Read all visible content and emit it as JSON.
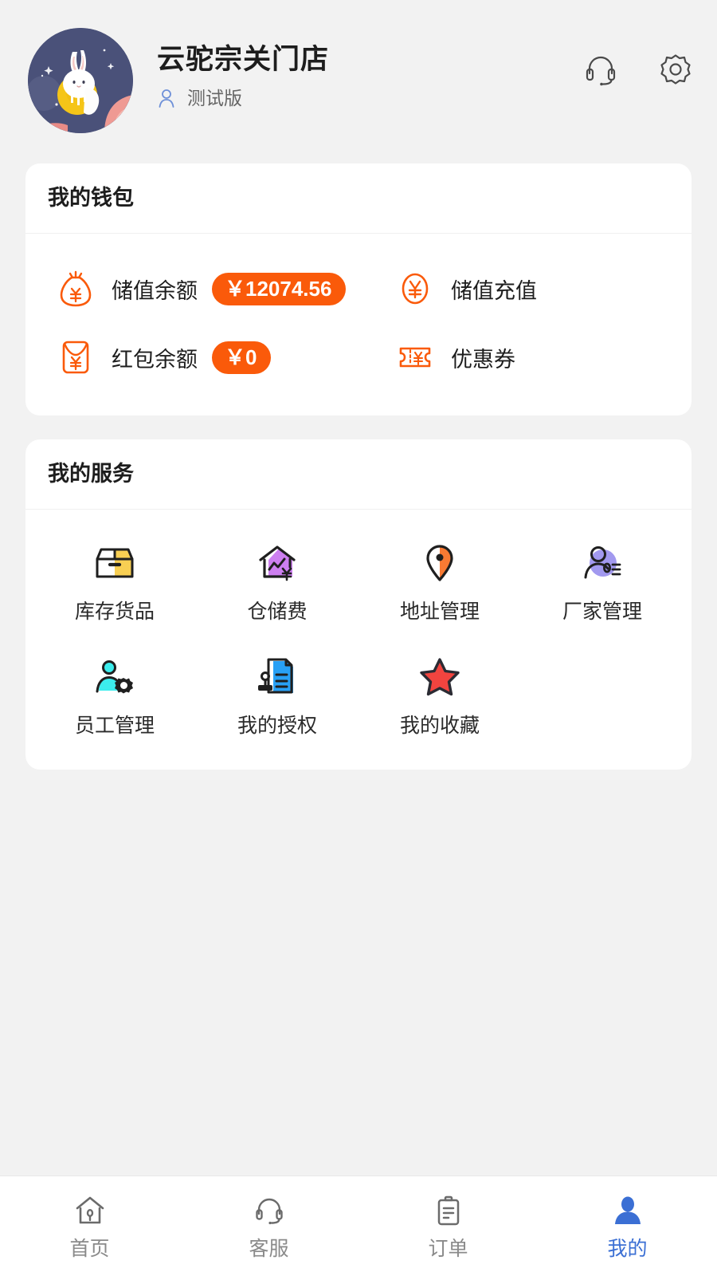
{
  "header": {
    "store_name": "云驼宗关门店",
    "badge_label": "测试版",
    "avatar_name": "rabbit-moon-avatar",
    "actions": [
      {
        "name": "customer-service-icon",
        "label": "客服"
      },
      {
        "name": "settings-gear-icon",
        "label": "设置"
      }
    ]
  },
  "wallet": {
    "title": "我的钱包",
    "items": [
      {
        "icon": "money-bag-icon",
        "label": "储值余额",
        "amount": "￥12074.56",
        "has_badge": true
      },
      {
        "icon": "yuan-circle-icon",
        "label": "储值充值",
        "amount": "",
        "has_badge": false
      },
      {
        "icon": "red-envelope-icon",
        "label": "红包余额",
        "amount": "￥0",
        "has_badge": true
      },
      {
        "icon": "coupon-ticket-icon",
        "label": "优惠券",
        "amount": "",
        "has_badge": false
      }
    ]
  },
  "services": {
    "title": "我的服务",
    "items": [
      {
        "icon": "box-icon",
        "label": "库存货品"
      },
      {
        "icon": "warehouse-fee-icon",
        "label": "仓储费"
      },
      {
        "icon": "location-pin-icon",
        "label": "地址管理"
      },
      {
        "icon": "factory-contact-icon",
        "label": "厂家管理"
      },
      {
        "icon": "employee-gear-icon",
        "label": "员工管理"
      },
      {
        "icon": "authorization-doc-icon",
        "label": "我的授权"
      },
      {
        "icon": "star-icon",
        "label": "我的收藏"
      }
    ]
  },
  "tabbar": {
    "tabs": [
      {
        "icon": "home-icon",
        "label": "首页",
        "active": false
      },
      {
        "icon": "headset-icon",
        "label": "客服",
        "active": false
      },
      {
        "icon": "clipboard-icon",
        "label": "订单",
        "active": false
      },
      {
        "icon": "person-icon",
        "label": "我的",
        "active": true
      }
    ]
  },
  "colors": {
    "accent_orange": "#fa5a0a",
    "active_blue": "#3b6fd4",
    "page_bg": "#f2f2f2",
    "card_bg": "#ffffff"
  }
}
